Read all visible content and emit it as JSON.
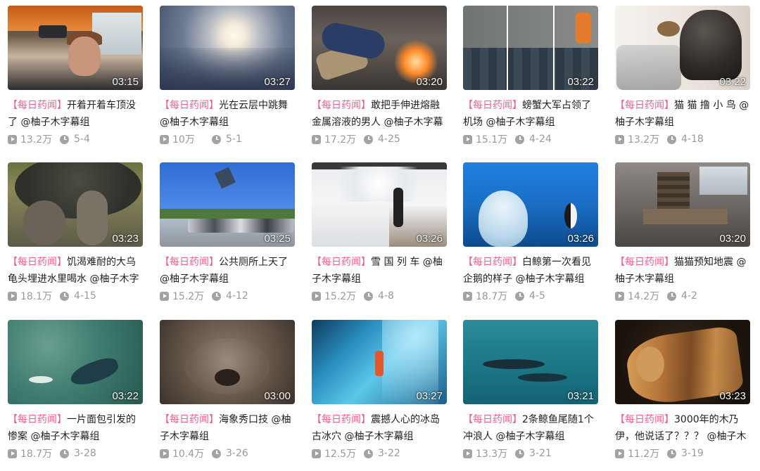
{
  "videos": [
    {
      "tag": "【每日药闻】",
      "title": "开着开着车顶没了 @柚子木字幕组",
      "duration": "03:15",
      "views": "13.2万",
      "date": "5-4"
    },
    {
      "tag": "【每日药闻】",
      "title": "光在云层中跳舞 @柚子木字幕组",
      "duration": "03:27",
      "views": "10万",
      "date": "5-1"
    },
    {
      "tag": "【每日药闻】",
      "title": "敢把手伸进熔融金属溶液的男人 @柚子木字幕",
      "duration": "03:20",
      "views": "17.2万",
      "date": "4-25"
    },
    {
      "tag": "【每日药闻】",
      "title": "螃蟹大军占领了机场 @柚子木字幕组",
      "duration": "03:22",
      "views": "15.1万",
      "date": "4-24"
    },
    {
      "tag": "【每日药闻】",
      "title": "猫 猫 撸 小 鸟 @柚子木字幕组",
      "duration": "03:22",
      "views": "13.2万",
      "date": "4-18"
    },
    {
      "tag": "【每日药闻】",
      "title": "饥渴难耐的大乌龟头埋进水里喝水 @柚子木字",
      "duration": "03:23",
      "views": "18.1万",
      "date": "4-15"
    },
    {
      "tag": "【每日药闻】",
      "title": "公共厕所上天了 @柚子木字幕组",
      "duration": "03:25",
      "views": "15.2万",
      "date": "4-12"
    },
    {
      "tag": "【每日药闻】",
      "title": "雪 国 列 车 @柚子木字幕组",
      "duration": "03:26",
      "views": "15.2万",
      "date": "4-8"
    },
    {
      "tag": "【每日药闻】",
      "title": "白鲸第一次看见企鹅的样子 @柚子木字幕组",
      "duration": "03:26",
      "views": "18.7万",
      "date": "4-5"
    },
    {
      "tag": "【每日药闻】",
      "title": "猫猫预知地震 @柚子木字幕组",
      "duration": "03:20",
      "views": "14.2万",
      "date": "4-2"
    },
    {
      "tag": "【每日药闻】",
      "title": "一片面包引发的惨案 @柚子木字幕组",
      "duration": "03:22",
      "views": "18.7万",
      "date": "3-28"
    },
    {
      "tag": "【每日药闻】",
      "title": "海象秀口技 @柚子木字幕组",
      "duration": "03:00",
      "views": "10.4万",
      "date": "3-26"
    },
    {
      "tag": "【每日药闻】",
      "title": "震撼人心的冰岛古冰穴 @柚子木字幕组",
      "duration": "03:27",
      "views": "12.5万",
      "date": "3-22"
    },
    {
      "tag": "【每日药闻】",
      "title": "2条鲸鱼尾随1个冲浪人 @柚子木字幕组",
      "duration": "03:21",
      "views": "13.3万",
      "date": "3-21"
    },
    {
      "tag": "【每日药闻】",
      "title": "3000年的木乃伊，他说话了？？？ @柚子木",
      "duration": "03:23",
      "views": "11.2万",
      "date": "3-19"
    }
  ],
  "icons": {
    "views": "play-count-icon",
    "date": "clock-icon"
  },
  "colors": {
    "tag": "#f25d8e",
    "title": "#212121",
    "meta": "#999999"
  }
}
